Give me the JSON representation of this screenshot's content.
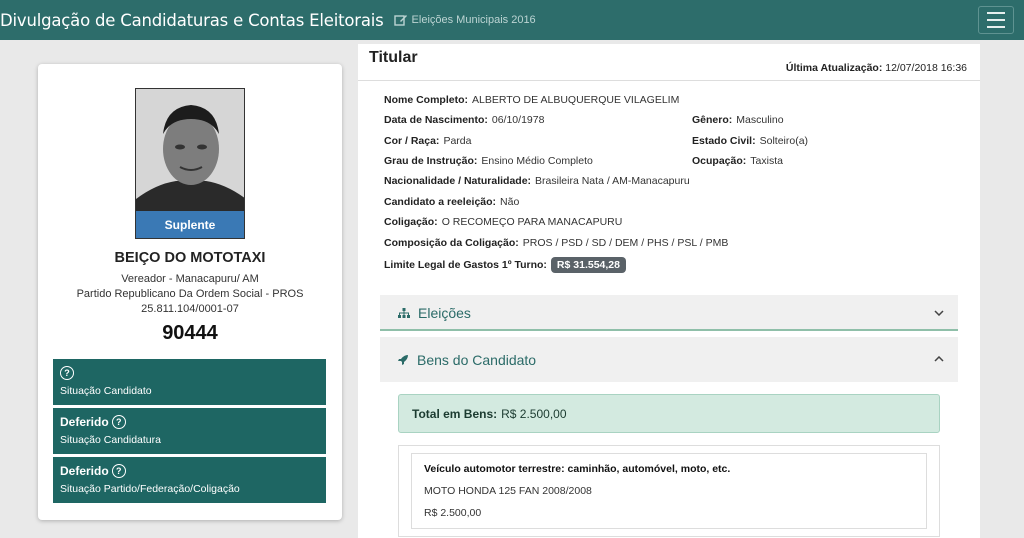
{
  "navbar": {
    "title": "Divulgação de Candidaturas e Contas Eleitorais",
    "subtitle": "Eleições Municipais 2016",
    "menu_icon": "hamburger-icon",
    "edit_icon": "edit-icon"
  },
  "candidate": {
    "photo_badge": "Suplente",
    "name": "BEIÇO DO MOTOTAXI",
    "office": "Vereador - Manacapuru/ AM",
    "party": "Partido Republicano Da Ordem Social - PROS",
    "cnpj": "25.811.104/0001-07",
    "number": "90444"
  },
  "status": [
    {
      "value": "",
      "label": "Situação Candidato"
    },
    {
      "value": "Deferido",
      "label": "Situação Candidatura"
    },
    {
      "value": "Deferido",
      "label": "Situação Partido/Federação/Coligação"
    }
  ],
  "details": {
    "title": "Titular",
    "update_label": "Última Atualização:",
    "update_value": "12/07/2018 16:36",
    "nome_label": "Nome Completo:",
    "nome": "ALBERTO DE ALBUQUERQUE VILAGELIM",
    "nasc_label": "Data de Nascimento:",
    "nasc": "06/10/1978",
    "genero_label": "Gênero:",
    "genero": "Masculino",
    "cor_label": "Cor / Raça:",
    "cor": "Parda",
    "civil_label": "Estado Civil:",
    "civil": "Solteiro(a)",
    "instr_label": "Grau de Instrução:",
    "instr": "Ensino Médio Completo",
    "ocup_label": "Ocupação:",
    "ocup": "Taxista",
    "nac_label": "Nacionalidade / Naturalidade:",
    "nac": "Brasileira Nata / AM-Manacapuru",
    "reel_label": "Candidato a reeleição:",
    "reel": "Não",
    "colig_label": "Coligação:",
    "colig": "O RECOMEÇO PARA MANACAPURU",
    "comp_label": "Composição da Coligação:",
    "comp": "PROS / PSD / SD / DEM / PHS / PSL / PMB",
    "limite_label": "Limite Legal de Gastos 1º Turno:",
    "limite": "R$ 31.554,28"
  },
  "accordions": {
    "eleicoes": "Eleições",
    "bens": "Bens do Candidato"
  },
  "bens": {
    "total_label": "Total em Bens:",
    "total_value": "R$ 2.500,00",
    "items": [
      {
        "type": "Veículo automotor terrestre: caminhão, automóvel, moto, etc.",
        "desc": "MOTO HONDA 125 FAN 2008/2008",
        "value": "R$ 2.500,00"
      }
    ]
  },
  "colors": {
    "navbar": "#2d6d6b",
    "status_box": "#1e6663",
    "badge_blue": "#3a79b5",
    "accent_text": "#2b6b68",
    "total_bg": "#d3eae0"
  }
}
